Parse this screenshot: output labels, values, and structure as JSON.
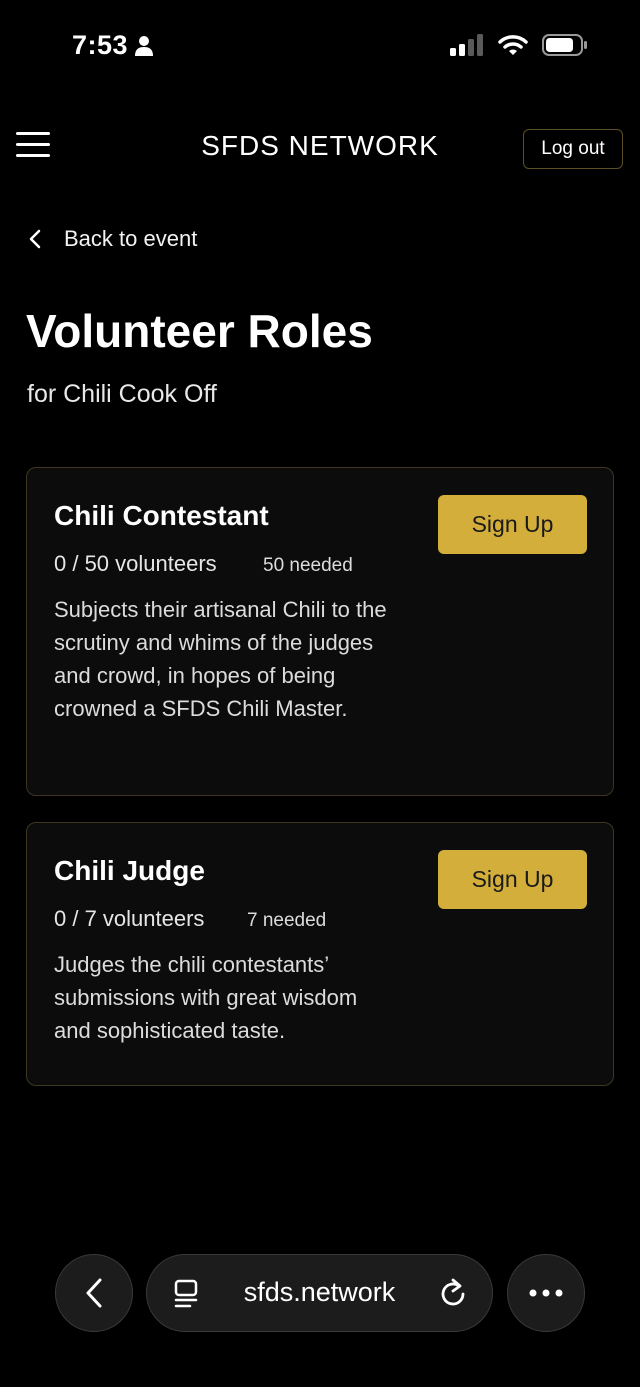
{
  "status_bar": {
    "time": "7:53"
  },
  "header": {
    "title": "SFDS NETWORK",
    "logout_label": "Log out"
  },
  "back_link": {
    "label": "Back to event"
  },
  "page": {
    "title": "Volunteer Roles",
    "subtitle": "for Chili Cook Off"
  },
  "roles": [
    {
      "name": "Chili Contestant",
      "count": "0 / 50 volunteers",
      "needed": "50 needed",
      "description": "Subjects their artisanal Chili to the scrutiny and whims of the judges and crowd, in hopes of being crowned a SFDS Chili Master.",
      "button_label": "Sign Up"
    },
    {
      "name": "Chili Judge",
      "count": "0 / 7 volunteers",
      "needed": "7 needed",
      "description": "Judges the chili contestants’ submissions with great wisdom and sophisticated taste.",
      "button_label": "Sign Up"
    }
  ],
  "browser_bar": {
    "url": "sfds.network"
  },
  "colors": {
    "accent": "#d4ae3a",
    "card_border": "#3c3622",
    "background": "#000000"
  }
}
